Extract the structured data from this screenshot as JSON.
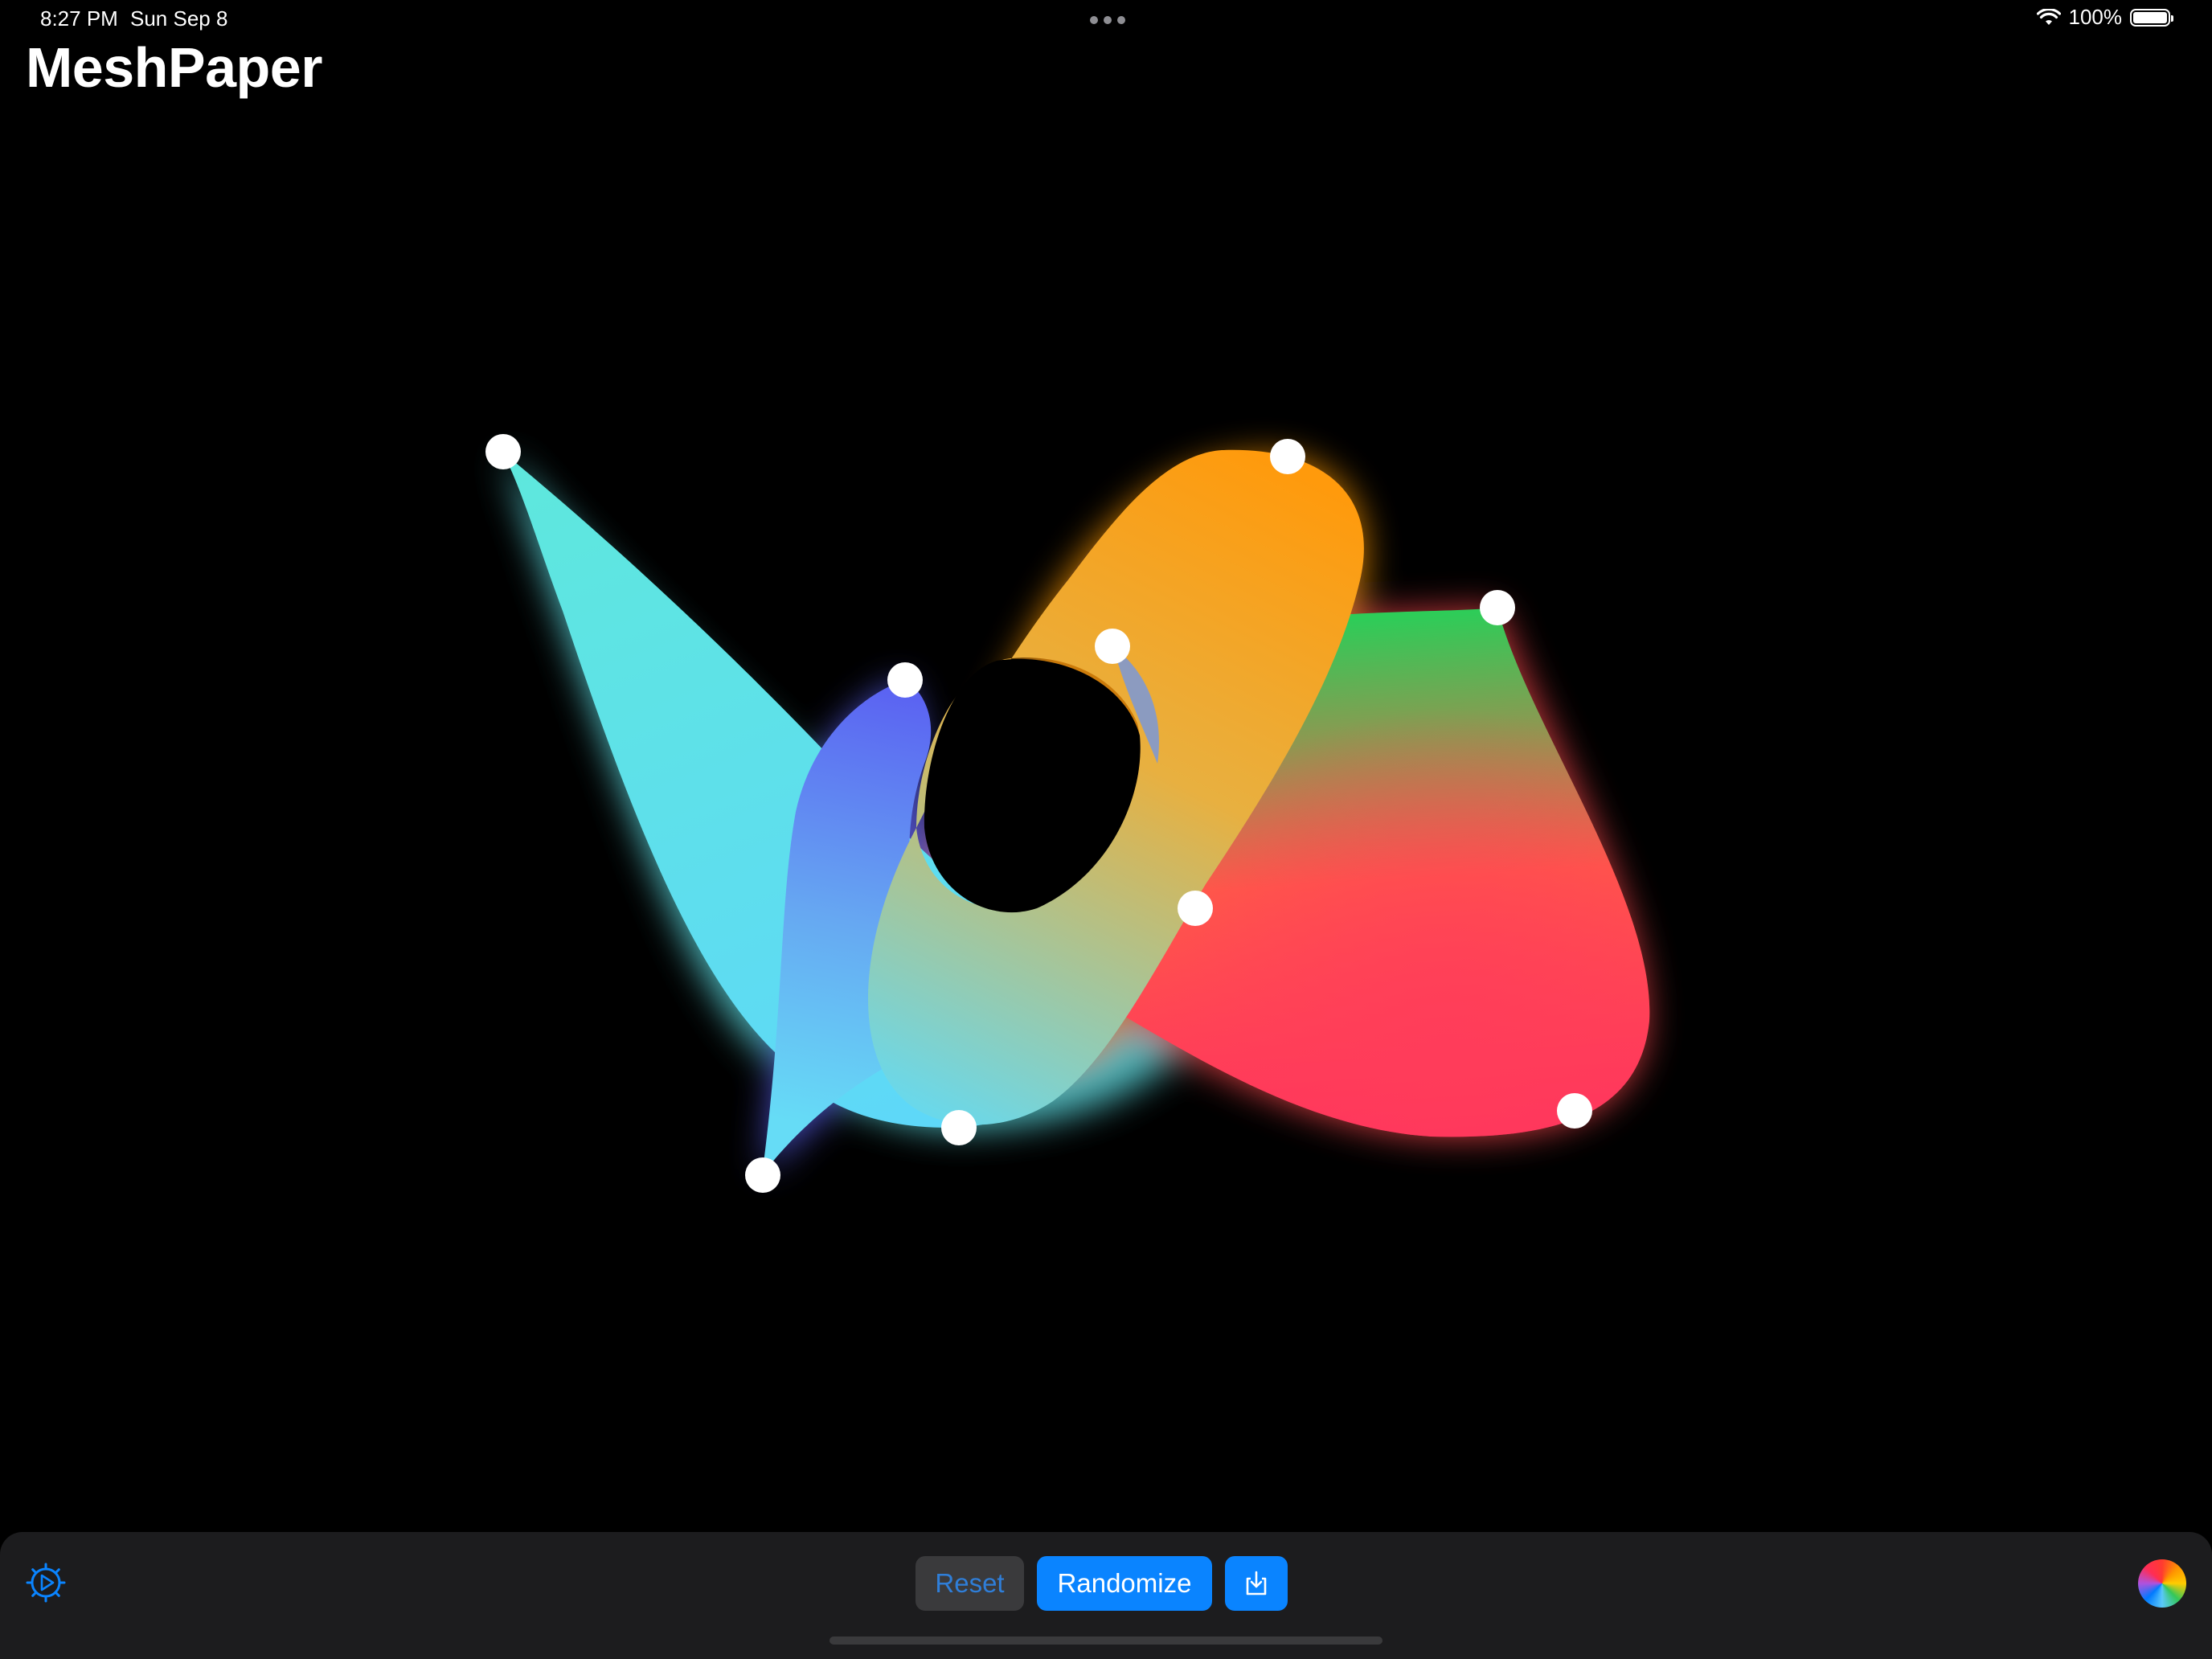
{
  "status_bar": {
    "time": "8:27 PM",
    "date": "Sun Sep 8",
    "battery": "100%",
    "battery_level": 1.0,
    "icons": [
      "wifi-icon",
      "battery-icon"
    ]
  },
  "app": {
    "title": "MeshPaper"
  },
  "mesh": {
    "colors": {
      "cyan": "#5ee6e6",
      "sky": "#60d8f8",
      "indigo": "#5a60f0",
      "orange": "#ff9a10",
      "green": "#30cc55",
      "red": "#ff3c50",
      "pink": "#ff3060",
      "control_point": "#ffffff"
    },
    "control_points_count": 10
  },
  "toolbar": {
    "reset_label": "Reset",
    "randomize_label": "Randomize",
    "icons": [
      "settings-gear-icon",
      "export-icon",
      "color-wheel-icon"
    ],
    "accent_color": "#0a84ff",
    "toolbar_background": "#1c1c1e"
  }
}
